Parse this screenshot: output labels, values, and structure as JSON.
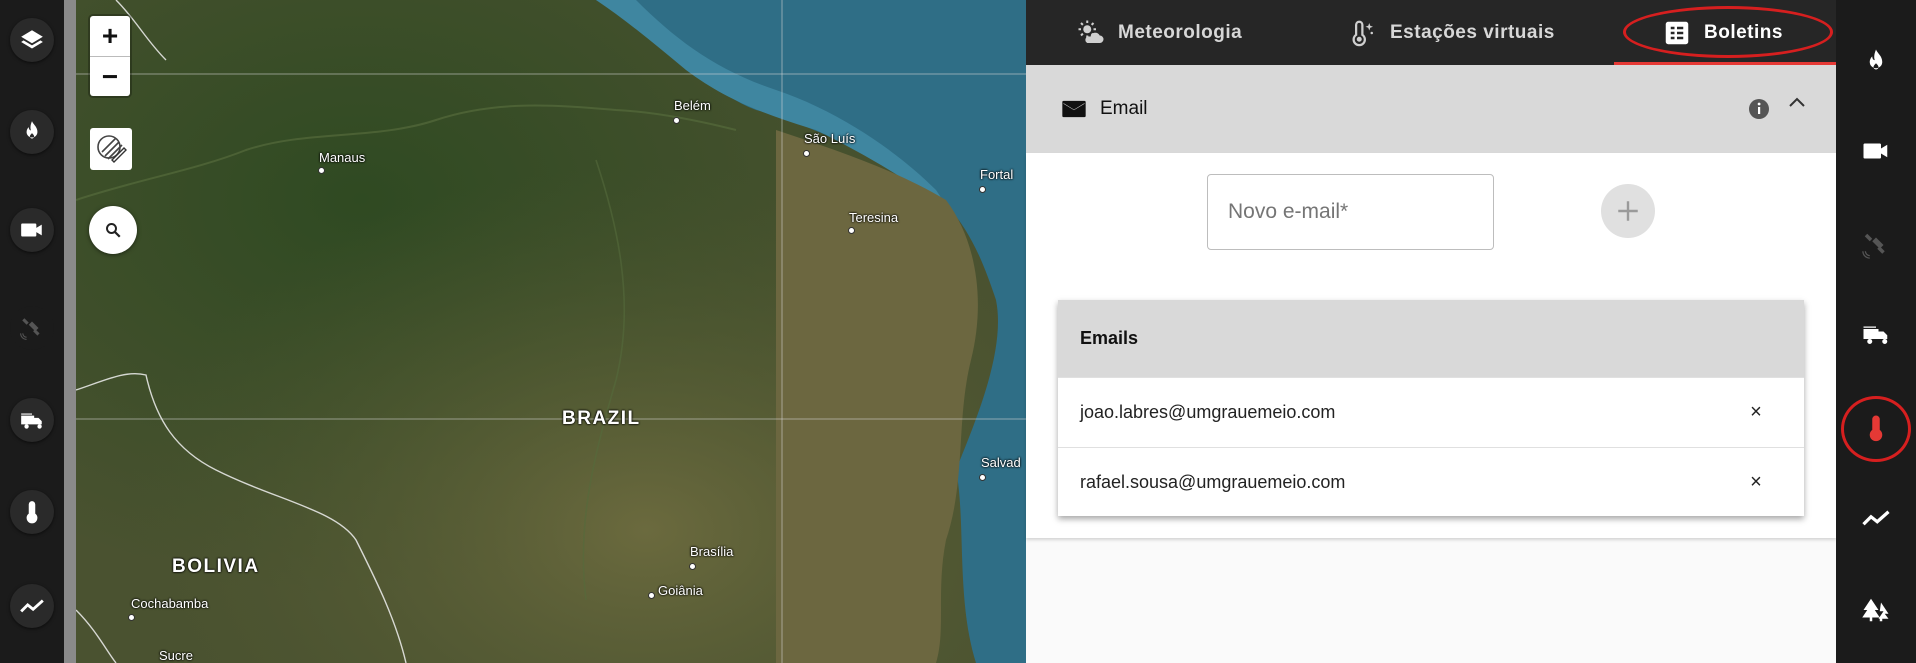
{
  "map": {
    "zoom_in": "+",
    "zoom_out": "−",
    "labels": {
      "belem": "Belém",
      "manaus": "Manaus",
      "sao_luis": "São Luís",
      "fortaleza": "Fortal",
      "teresina": "Teresina",
      "brazil": "BRAZIL",
      "salvador": "Salvad",
      "bolivia": "BOLIVIA",
      "cochabamba": "Cochabamba",
      "brasilia": "Brasília",
      "goiania": "Goiânia",
      "sucre": "Sucre"
    }
  },
  "tabs": [
    {
      "label": "Meteorologia",
      "icon": "weather-icon"
    },
    {
      "label": "Estações virtuais",
      "icon": "thermometer-sparkle-icon"
    },
    {
      "label": "Boletins",
      "icon": "bulletin-icon",
      "active": true
    }
  ],
  "email_section": {
    "title": "Email",
    "input_placeholder": "Novo e-mail*",
    "table_header": "Emails",
    "rows": [
      {
        "email": "joao.labres@umgrauemeio.com",
        "delete": "×"
      },
      {
        "email": "rafael.sousa@umgrauemeio.com",
        "delete": "×"
      }
    ]
  },
  "colors": {
    "accent": "#e53935",
    "panel_header": "#d9d9d9",
    "sidebar": "#1b1b1b"
  }
}
